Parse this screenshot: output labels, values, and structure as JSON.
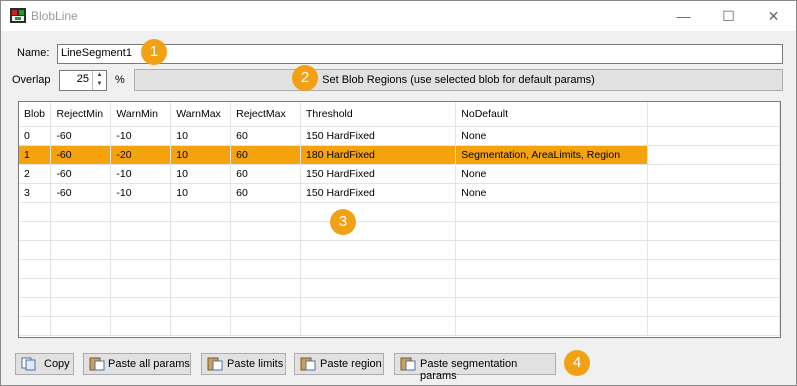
{
  "window": {
    "title": "BlobLine",
    "minimize": "—",
    "maximize": "☐",
    "close": "✕"
  },
  "name": {
    "label": "Name:",
    "value": "LineSegment1"
  },
  "overlap": {
    "label": "Overlap",
    "value": "25",
    "unit": "%"
  },
  "set_regions_button": "Set Blob Regions (use selected blob for default params)",
  "callouts": [
    "1",
    "2",
    "3",
    "4"
  ],
  "grid": {
    "columns": [
      "Blob",
      "RejectMin",
      "WarnMin",
      "WarnMax",
      "RejectMax",
      "Threshold",
      "NoDefault"
    ],
    "rows": [
      [
        "0",
        "-60",
        "-10",
        "10",
        "60",
        "150 HardFixed",
        "None"
      ],
      [
        "1",
        "-60",
        "-20",
        "10",
        "60",
        "180 HardFixed",
        "Segmentation, AreaLimits, Region"
      ],
      [
        "2",
        "-60",
        "-10",
        "10",
        "60",
        "150 HardFixed",
        "None"
      ],
      [
        "3",
        "-60",
        "-10",
        "10",
        "60",
        "150 HardFixed",
        "None"
      ]
    ],
    "selected_row": 1,
    "highlight_color": "#f5a30c"
  },
  "bottom_buttons": {
    "copy": "Copy",
    "paste_all": "Paste all params",
    "paste_limits": "Paste limits",
    "paste_region": "Paste region",
    "paste_segmentation": "Paste segmentation params"
  },
  "accent_color": "#f2a114"
}
